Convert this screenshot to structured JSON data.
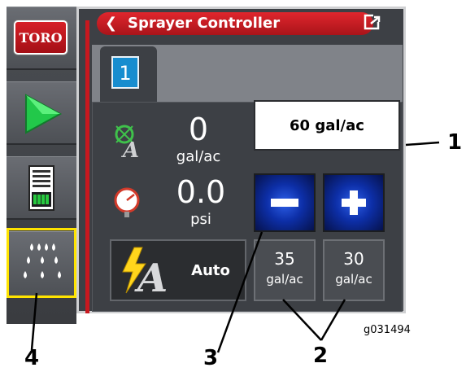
{
  "sidebar": {
    "logo_text": "TORO",
    "items": [
      {
        "name": "home",
        "icon": "toro-logo"
      },
      {
        "name": "run",
        "icon": "play-icon"
      },
      {
        "name": "report",
        "icon": "report-icon"
      },
      {
        "name": "sprayer-controller",
        "icon": "nozzle-icon",
        "highlighted": true
      }
    ]
  },
  "window": {
    "title": "Sprayer Controller",
    "active_tab": "1"
  },
  "readings": {
    "rate_value": "0",
    "rate_unit": "gal/ac",
    "pressure_value": "0.0",
    "pressure_unit": "psi"
  },
  "controls": {
    "target_rate": "60 gal/ac",
    "mode_label": "Auto",
    "presets": [
      {
        "value": "35",
        "unit": "gal/ac"
      },
      {
        "value": "30",
        "unit": "gal/ac"
      }
    ]
  },
  "callouts": {
    "one": "1",
    "two": "2",
    "three": "3",
    "four": "4",
    "figure_code": "g031494"
  },
  "colors": {
    "accent_red": "#c8181f",
    "tab_blue": "#178dcf",
    "highlight_yellow": "#ffe400",
    "button_blue": "#2d5fe8"
  }
}
